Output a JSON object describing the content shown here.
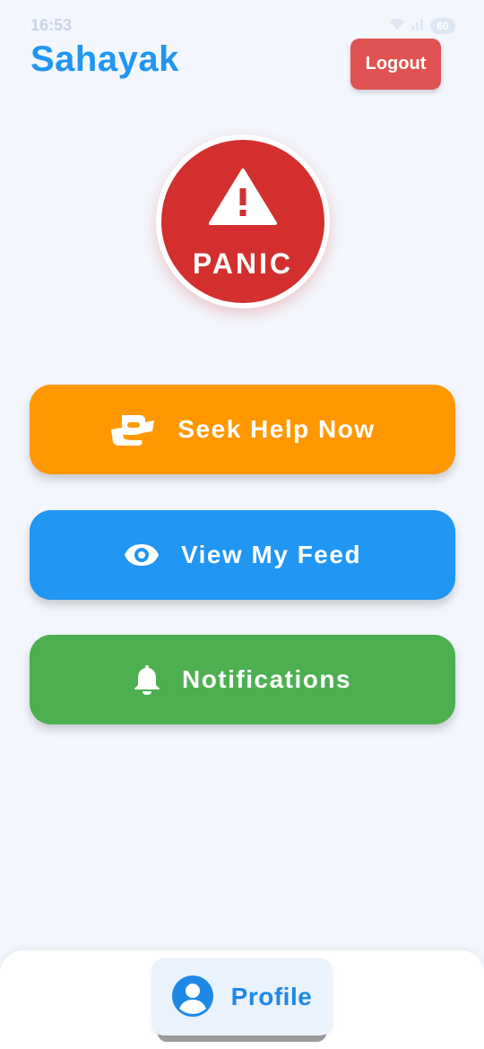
{
  "status_bar": {
    "time": "16:53",
    "battery": "60"
  },
  "header": {
    "title": "Sahayak",
    "logout_label": "Logout"
  },
  "panic": {
    "label": "PANIC"
  },
  "actions": [
    {
      "label": "Seek Help Now",
      "icon": "helping-hands-icon",
      "color": "#ff9800"
    },
    {
      "label": "View My Feed",
      "icon": "eye-icon",
      "color": "#2196f3"
    },
    {
      "label": "Notifications",
      "icon": "bell-icon",
      "color": "#4caf50"
    }
  ],
  "bottom_nav": {
    "profile_label": "Profile",
    "icon": "user-avatar-icon"
  },
  "colors": {
    "brand": "#2196f3",
    "panic": "#d32f2f",
    "logout": "#e05252",
    "background": "#f3f7fd"
  }
}
